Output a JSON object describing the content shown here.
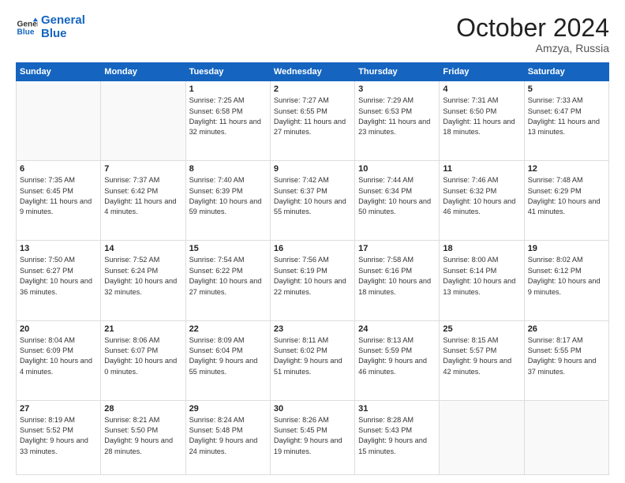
{
  "logo": {
    "line1": "General",
    "line2": "Blue"
  },
  "title": "October 2024",
  "location": "Amzya, Russia",
  "days_header": [
    "Sunday",
    "Monday",
    "Tuesday",
    "Wednesday",
    "Thursday",
    "Friday",
    "Saturday"
  ],
  "weeks": [
    [
      {
        "day": "",
        "info": ""
      },
      {
        "day": "",
        "info": ""
      },
      {
        "day": "1",
        "info": "Sunrise: 7:25 AM\nSunset: 6:58 PM\nDaylight: 11 hours and 32 minutes."
      },
      {
        "day": "2",
        "info": "Sunrise: 7:27 AM\nSunset: 6:55 PM\nDaylight: 11 hours and 27 minutes."
      },
      {
        "day": "3",
        "info": "Sunrise: 7:29 AM\nSunset: 6:53 PM\nDaylight: 11 hours and 23 minutes."
      },
      {
        "day": "4",
        "info": "Sunrise: 7:31 AM\nSunset: 6:50 PM\nDaylight: 11 hours and 18 minutes."
      },
      {
        "day": "5",
        "info": "Sunrise: 7:33 AM\nSunset: 6:47 PM\nDaylight: 11 hours and 13 minutes."
      }
    ],
    [
      {
        "day": "6",
        "info": "Sunrise: 7:35 AM\nSunset: 6:45 PM\nDaylight: 11 hours and 9 minutes."
      },
      {
        "day": "7",
        "info": "Sunrise: 7:37 AM\nSunset: 6:42 PM\nDaylight: 11 hours and 4 minutes."
      },
      {
        "day": "8",
        "info": "Sunrise: 7:40 AM\nSunset: 6:39 PM\nDaylight: 10 hours and 59 minutes."
      },
      {
        "day": "9",
        "info": "Sunrise: 7:42 AM\nSunset: 6:37 PM\nDaylight: 10 hours and 55 minutes."
      },
      {
        "day": "10",
        "info": "Sunrise: 7:44 AM\nSunset: 6:34 PM\nDaylight: 10 hours and 50 minutes."
      },
      {
        "day": "11",
        "info": "Sunrise: 7:46 AM\nSunset: 6:32 PM\nDaylight: 10 hours and 46 minutes."
      },
      {
        "day": "12",
        "info": "Sunrise: 7:48 AM\nSunset: 6:29 PM\nDaylight: 10 hours and 41 minutes."
      }
    ],
    [
      {
        "day": "13",
        "info": "Sunrise: 7:50 AM\nSunset: 6:27 PM\nDaylight: 10 hours and 36 minutes."
      },
      {
        "day": "14",
        "info": "Sunrise: 7:52 AM\nSunset: 6:24 PM\nDaylight: 10 hours and 32 minutes."
      },
      {
        "day": "15",
        "info": "Sunrise: 7:54 AM\nSunset: 6:22 PM\nDaylight: 10 hours and 27 minutes."
      },
      {
        "day": "16",
        "info": "Sunrise: 7:56 AM\nSunset: 6:19 PM\nDaylight: 10 hours and 22 minutes."
      },
      {
        "day": "17",
        "info": "Sunrise: 7:58 AM\nSunset: 6:16 PM\nDaylight: 10 hours and 18 minutes."
      },
      {
        "day": "18",
        "info": "Sunrise: 8:00 AM\nSunset: 6:14 PM\nDaylight: 10 hours and 13 minutes."
      },
      {
        "day": "19",
        "info": "Sunrise: 8:02 AM\nSunset: 6:12 PM\nDaylight: 10 hours and 9 minutes."
      }
    ],
    [
      {
        "day": "20",
        "info": "Sunrise: 8:04 AM\nSunset: 6:09 PM\nDaylight: 10 hours and 4 minutes."
      },
      {
        "day": "21",
        "info": "Sunrise: 8:06 AM\nSunset: 6:07 PM\nDaylight: 10 hours and 0 minutes."
      },
      {
        "day": "22",
        "info": "Sunrise: 8:09 AM\nSunset: 6:04 PM\nDaylight: 9 hours and 55 minutes."
      },
      {
        "day": "23",
        "info": "Sunrise: 8:11 AM\nSunset: 6:02 PM\nDaylight: 9 hours and 51 minutes."
      },
      {
        "day": "24",
        "info": "Sunrise: 8:13 AM\nSunset: 5:59 PM\nDaylight: 9 hours and 46 minutes."
      },
      {
        "day": "25",
        "info": "Sunrise: 8:15 AM\nSunset: 5:57 PM\nDaylight: 9 hours and 42 minutes."
      },
      {
        "day": "26",
        "info": "Sunrise: 8:17 AM\nSunset: 5:55 PM\nDaylight: 9 hours and 37 minutes."
      }
    ],
    [
      {
        "day": "27",
        "info": "Sunrise: 8:19 AM\nSunset: 5:52 PM\nDaylight: 9 hours and 33 minutes."
      },
      {
        "day": "28",
        "info": "Sunrise: 8:21 AM\nSunset: 5:50 PM\nDaylight: 9 hours and 28 minutes."
      },
      {
        "day": "29",
        "info": "Sunrise: 8:24 AM\nSunset: 5:48 PM\nDaylight: 9 hours and 24 minutes."
      },
      {
        "day": "30",
        "info": "Sunrise: 8:26 AM\nSunset: 5:45 PM\nDaylight: 9 hours and 19 minutes."
      },
      {
        "day": "31",
        "info": "Sunrise: 8:28 AM\nSunset: 5:43 PM\nDaylight: 9 hours and 15 minutes."
      },
      {
        "day": "",
        "info": ""
      },
      {
        "day": "",
        "info": ""
      }
    ]
  ]
}
